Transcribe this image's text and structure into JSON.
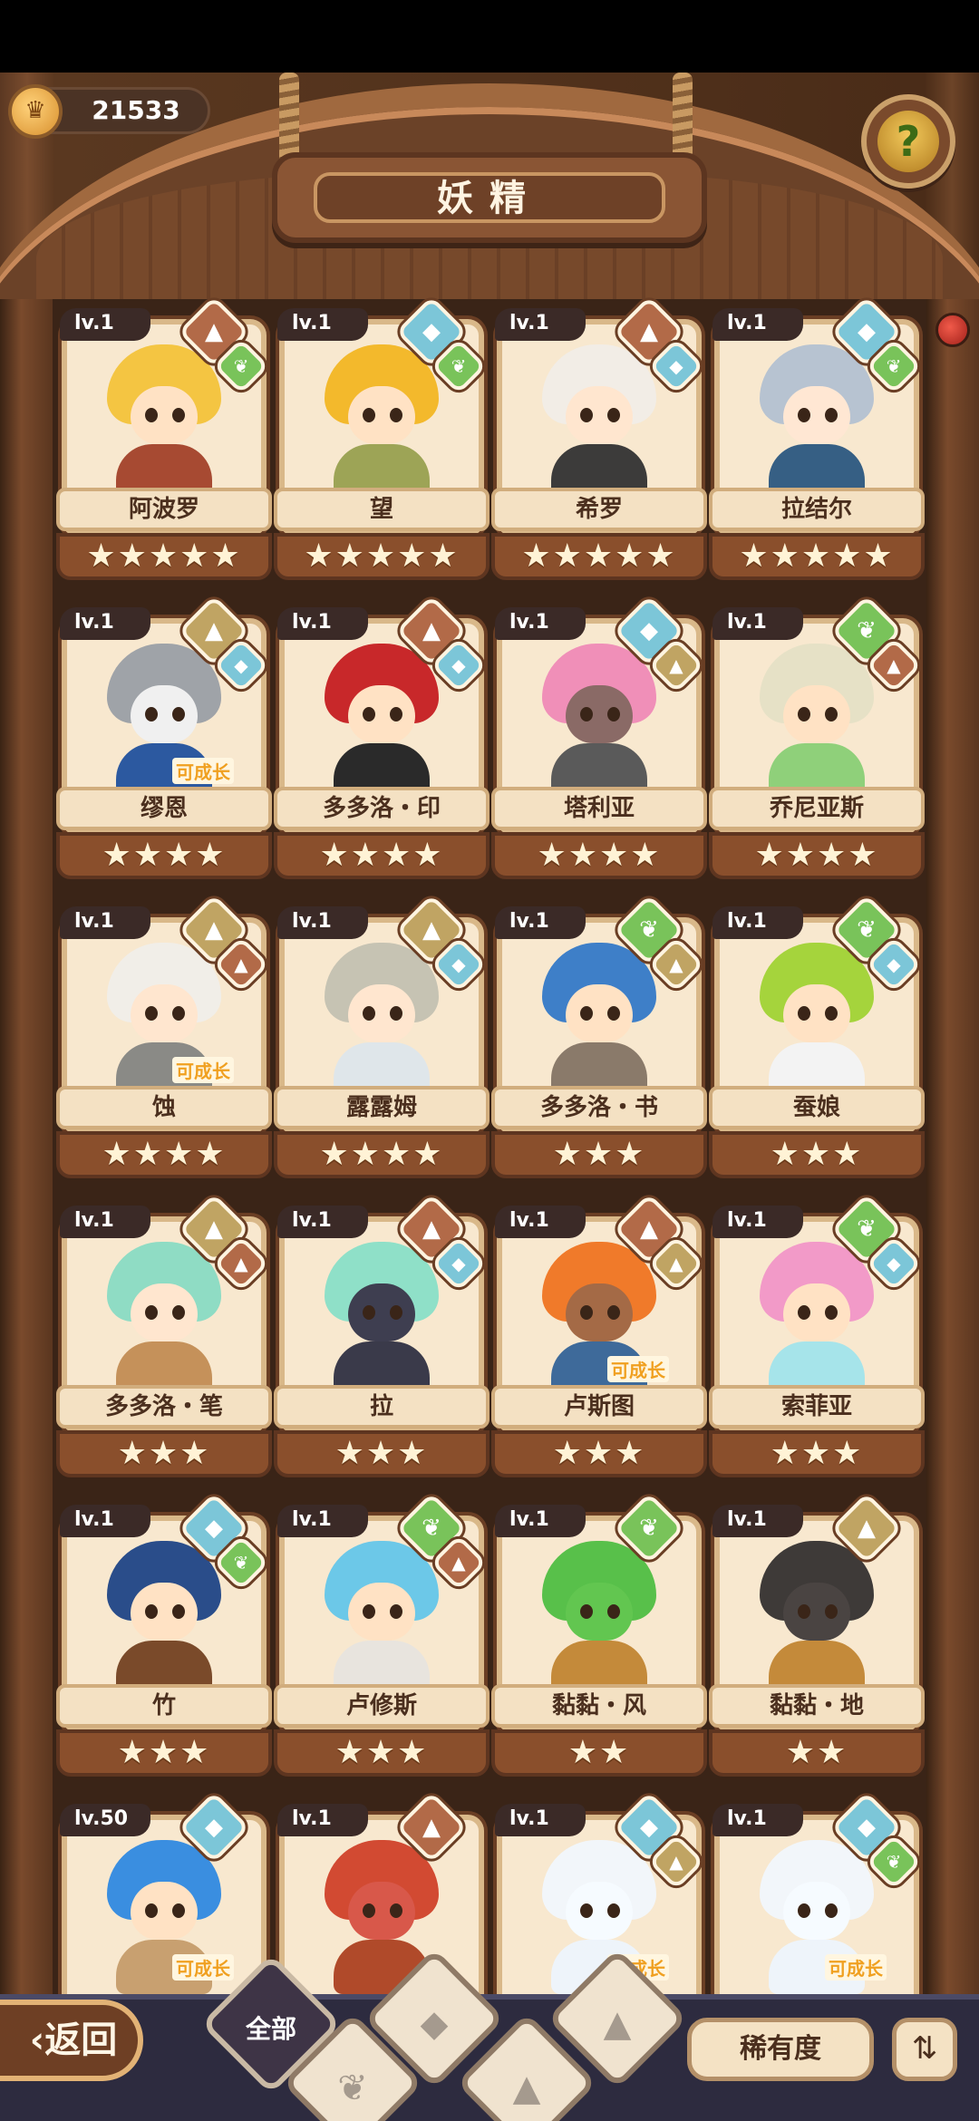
{
  "header": {
    "title": "妖精",
    "currency": {
      "value": "21533",
      "icon": "coin-icon"
    },
    "help_icon": "question-sprout-icon"
  },
  "colors": {
    "fire": "#b26a48",
    "water": "#7cc6d8",
    "grass": "#79c35a",
    "earth": "#c0a463",
    "card": "#f8e8cf",
    "wood": "#6b4228"
  },
  "grow_label": "可成长",
  "cards": [
    {
      "lv": "lv.1",
      "name": "阿波罗",
      "stars": "★★★★★",
      "elements": [
        "fire",
        "grass"
      ],
      "grow": false,
      "hair": "#f4c542",
      "face": "#ffe2c4",
      "body": "#a74a32"
    },
    {
      "lv": "lv.1",
      "name": "望",
      "stars": "★★★★★",
      "elements": [
        "water",
        "grass"
      ],
      "grow": false,
      "hair": "#f3b92c",
      "face": "#ffe2c4",
      "body": "#9da456"
    },
    {
      "lv": "lv.1",
      "name": "希罗",
      "stars": "★★★★★",
      "elements": [
        "fire",
        "water"
      ],
      "grow": false,
      "hair": "#f2ede6",
      "face": "#ffe6cf",
      "body": "#3c3b3a"
    },
    {
      "lv": "lv.1",
      "name": "拉结尔",
      "stars": "★★★★★",
      "elements": [
        "water",
        "grass"
      ],
      "grow": false,
      "hair": "#b7c3d1",
      "face": "#ffe7d3",
      "body": "#365f84"
    },
    {
      "lv": "lv.1",
      "name": "缪恩",
      "stars": "★★★★",
      "elements": [
        "earth",
        "water"
      ],
      "grow": true,
      "hair": "#9fa3a8",
      "face": "#f0f0f0",
      "body": "#2c59a0"
    },
    {
      "lv": "lv.1",
      "name": "多多洛・印",
      "stars": "★★★★",
      "elements": [
        "fire",
        "water"
      ],
      "grow": false,
      "hair": "#c8282a",
      "face": "#ffe2c4",
      "body": "#2a2a2a"
    },
    {
      "lv": "lv.1",
      "name": "塔利亚",
      "stars": "★★★★",
      "elements": [
        "water",
        "earth"
      ],
      "grow": false,
      "hair": "#f08fb8",
      "face": "#8a6a66",
      "body": "#5a5a5a"
    },
    {
      "lv": "lv.1",
      "name": "乔尼亚斯",
      "stars": "★★★★",
      "elements": [
        "grass",
        "fire"
      ],
      "grow": false,
      "hair": "#e6e1c6",
      "face": "#ffe2c4",
      "body": "#8fd07a"
    },
    {
      "lv": "lv.1",
      "name": "蚀",
      "stars": "★★★★",
      "elements": [
        "earth",
        "fire"
      ],
      "grow": true,
      "hair": "#f1eee8",
      "face": "#ffe6cf",
      "body": "#8a8a86"
    },
    {
      "lv": "lv.1",
      "name": "露露姆",
      "stars": "★★★★",
      "elements": [
        "earth",
        "water"
      ],
      "grow": false,
      "hair": "#c6c3b3",
      "face": "#ffe6cf",
      "body": "#dfe6ea"
    },
    {
      "lv": "lv.1",
      "name": "多多洛・书",
      "stars": "★★★",
      "elements": [
        "grass",
        "earth"
      ],
      "grow": false,
      "hair": "#3e7fc8",
      "face": "#ffe2c4",
      "body": "#8a7a6a"
    },
    {
      "lv": "lv.1",
      "name": "蚕娘",
      "stars": "★★★",
      "elements": [
        "grass",
        "water"
      ],
      "grow": false,
      "hair": "#a5d43c",
      "face": "#ffe2c4",
      "body": "#f3f3f3"
    },
    {
      "lv": "lv.1",
      "name": "多多洛・笔",
      "stars": "★★★",
      "elements": [
        "earth",
        "fire"
      ],
      "grow": false,
      "hair": "#8fdcc4",
      "face": "#ffe6cf",
      "body": "#c5915a"
    },
    {
      "lv": "lv.1",
      "name": "拉",
      "stars": "★★★",
      "elements": [
        "fire",
        "water"
      ],
      "grow": false,
      "hair": "#8fe0c8",
      "face": "#3e3e50",
      "body": "#3a3a4a"
    },
    {
      "lv": "lv.1",
      "name": "卢斯图",
      "stars": "★★★",
      "elements": [
        "fire",
        "earth"
      ],
      "grow": true,
      "hair": "#f07a2a",
      "face": "#a46a46",
      "body": "#3e6a9a"
    },
    {
      "lv": "lv.1",
      "name": "索菲亚",
      "stars": "★★★",
      "elements": [
        "grass",
        "water"
      ],
      "grow": false,
      "hair": "#f29ac8",
      "face": "#ffe2c4",
      "body": "#a6e4ea"
    },
    {
      "lv": "lv.1",
      "name": "竹",
      "stars": "★★★",
      "elements": [
        "water",
        "grass"
      ],
      "grow": false,
      "hair": "#2a4d8a",
      "face": "#ffe2c4",
      "body": "#7a4a2a"
    },
    {
      "lv": "lv.1",
      "name": "卢修斯",
      "stars": "★★★",
      "elements": [
        "grass",
        "fire"
      ],
      "grow": false,
      "hair": "#6cc8e8",
      "face": "#ffe2c4",
      "body": "#e8e4de"
    },
    {
      "lv": "lv.1",
      "name": "黏黏・风",
      "stars": "★★",
      "elements": [
        "grass"
      ],
      "grow": false,
      "hair": "#58c04a",
      "face": "#62c650",
      "body": "#c48a3a"
    },
    {
      "lv": "lv.1",
      "name": "黏黏・地",
      "stars": "★★",
      "elements": [
        "earth"
      ],
      "grow": false,
      "hair": "#3e3a38",
      "face": "#4a4442",
      "body": "#c48a3a"
    },
    {
      "lv": "lv.50",
      "name": "",
      "stars": "",
      "elements": [
        "water"
      ],
      "grow": true,
      "hair": "#3a8ee0",
      "face": "#ffe2c4",
      "body": "#c8a070"
    },
    {
      "lv": "lv.1",
      "name": "",
      "stars": "",
      "elements": [
        "fire"
      ],
      "grow": false,
      "hair": "#d24a32",
      "face": "#d8584a",
      "body": "#b04a2a"
    },
    {
      "lv": "lv.1",
      "name": "",
      "stars": "",
      "elements": [
        "water",
        "earth"
      ],
      "grow": true,
      "hair": "#f2f6fa",
      "face": "#f6fbff",
      "body": "#eef4fa"
    },
    {
      "lv": "lv.1",
      "name": "",
      "stars": "",
      "elements": [
        "water",
        "grass"
      ],
      "grow": true,
      "hair": "#f2f6fa",
      "face": "#f6fbff",
      "body": "#eef4fa"
    }
  ],
  "bottom": {
    "back_label": "返回",
    "back_icon": "chevron-left-icon",
    "filters": {
      "all_label": "全部",
      "grass_icon": "sprout-icon",
      "water_icon": "water-drop-icon",
      "earth_icon": "mountain-icon",
      "fire_icon": "volcano-icon"
    },
    "rarity_label": "稀有度",
    "sort_icon": "sort-icon"
  }
}
